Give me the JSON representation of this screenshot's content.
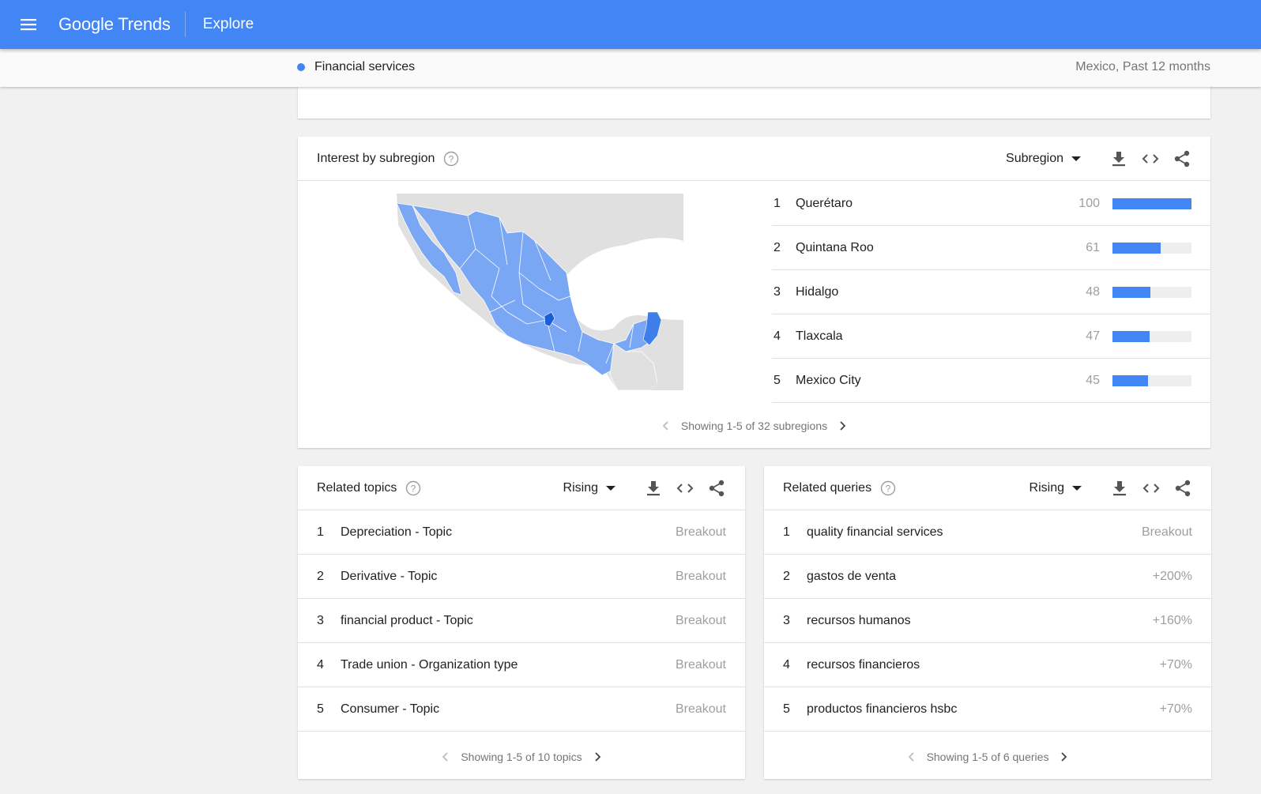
{
  "appbar": {
    "logo": "Google Trends",
    "title": "Explore"
  },
  "subbar": {
    "term": "Financial services",
    "scope": "Mexico, Past 12 months"
  },
  "colors": {
    "brand": "#4285f4",
    "map_high": "#1a5fd6",
    "map_base": "#7aa7f4",
    "map_other": "#e0e0e0"
  },
  "subregion": {
    "title": "Interest by subregion",
    "select_value": "Subregion",
    "rows": [
      {
        "rank": "1",
        "name": "Querétaro",
        "value": "100",
        "fill": 100
      },
      {
        "rank": "2",
        "name": "Quintana Roo",
        "value": "61",
        "fill": 61
      },
      {
        "rank": "3",
        "name": "Hidalgo",
        "value": "48",
        "fill": 48
      },
      {
        "rank": "4",
        "name": "Tlaxcala",
        "value": "47",
        "fill": 47
      },
      {
        "rank": "5",
        "name": "Mexico City",
        "value": "45",
        "fill": 45
      }
    ],
    "pager": "Showing 1-5 of 32 subregions"
  },
  "topics": {
    "title": "Related topics",
    "select_value": "Rising",
    "rows": [
      {
        "rank": "1",
        "name": "Depreciation - Topic",
        "value": "Breakout"
      },
      {
        "rank": "2",
        "name": "Derivative - Topic",
        "value": "Breakout"
      },
      {
        "rank": "3",
        "name": "financial product - Topic",
        "value": "Breakout"
      },
      {
        "rank": "4",
        "name": "Trade union - Organization type",
        "value": "Breakout"
      },
      {
        "rank": "5",
        "name": "Consumer - Topic",
        "value": "Breakout"
      }
    ],
    "pager": "Showing 1-5 of 10 topics"
  },
  "queries": {
    "title": "Related queries",
    "select_value": "Rising",
    "rows": [
      {
        "rank": "1",
        "name": "quality financial services",
        "value": "Breakout"
      },
      {
        "rank": "2",
        "name": "gastos de venta",
        "value": "+200%"
      },
      {
        "rank": "3",
        "name": "recursos humanos",
        "value": "+160%"
      },
      {
        "rank": "4",
        "name": "recursos financieros",
        "value": "+70%"
      },
      {
        "rank": "5",
        "name": "productos financieros hsbc",
        "value": "+70%"
      }
    ],
    "pager": "Showing 1-5 of 6 queries"
  }
}
